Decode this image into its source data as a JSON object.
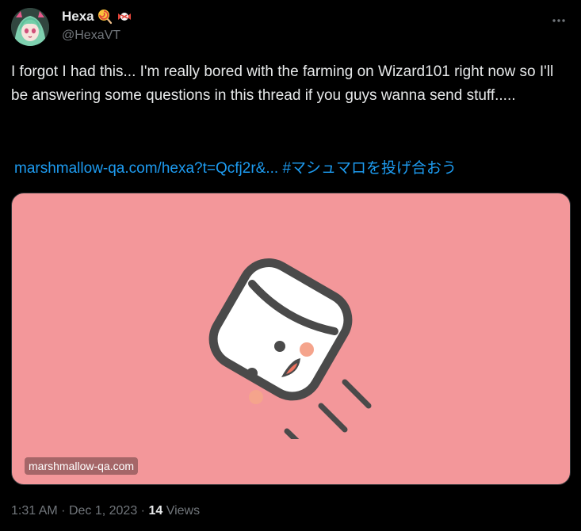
{
  "author": {
    "display_name": "Hexa",
    "handle": "@HexaVT",
    "name_emojis": [
      "lollipop-emoji",
      "candy-emoji"
    ]
  },
  "tweet": {
    "text": "I forgot I had this... I'm really bored with the farming on Wizard101 right now so I'll be answering some questions in this thread if you guys wanna send stuff.....",
    "link_text": "marshmallow-qa.com/hexa?t=Qcfj2r&...",
    "hashtag": "#マシュマロを投げ合おう"
  },
  "card": {
    "domain": "marshmallow-qa.com",
    "background": "#f3979a",
    "image_icon": "marshmallow-mascot-icon"
  },
  "meta": {
    "time": "1:31 AM",
    "separator": "·",
    "date": "Dec 1, 2023",
    "views_count": "14",
    "views_label": "Views"
  },
  "colors": {
    "background": "#000000",
    "text": "#e7e9ea",
    "secondary": "#71767b",
    "link": "#1d9bf0"
  }
}
